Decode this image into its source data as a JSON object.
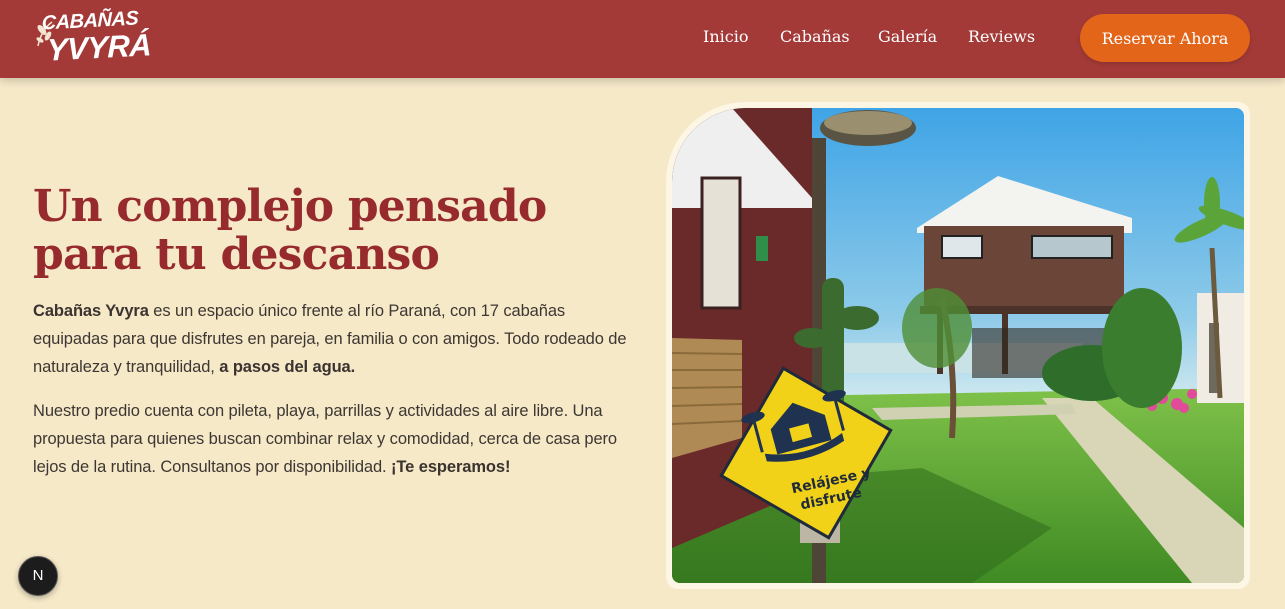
{
  "brand": {
    "logo_top": "CABAÑAS",
    "logo_bottom": "YVYRÁ",
    "logo_icon": "leaf-icon"
  },
  "nav": {
    "items": [
      {
        "label": "Inicio"
      },
      {
        "label": "Cabañas"
      },
      {
        "label": "Galería"
      },
      {
        "label": "Reviews"
      }
    ],
    "cta_label": "Reservar Ahora"
  },
  "hero": {
    "title": "Un complejo pensado para tu descanso",
    "paragraph1": {
      "strong_lead": "Cabañas Yvyra",
      "text": " es un espacio único frente al río Paraná, con 17 cabañas equipadas para que disfrutes en pareja, en familia o con amigos. Todo rodeado de naturaleza y tranquilidad, ",
      "strong_tail": "a pasos del agua."
    },
    "paragraph2": {
      "text": "Nuestro predio cuenta con pileta, playa, parrillas y actividades al aire libre. Una propuesta para quienes buscan combinar relax y comodidad, cerca de casa pero lejos de la rutina. Consultanos por disponibilidad. ",
      "strong_tail": "¡Te esperamos!"
    },
    "image": {
      "sign_line1": "Relájese y",
      "sign_line2": "disfrute"
    }
  },
  "dev_badge": {
    "letter": "N"
  },
  "colors": {
    "header_bg": "#a33a38",
    "page_bg": "#f6e9c8",
    "title": "#962a2d",
    "cta_bg": "#e3651a"
  }
}
